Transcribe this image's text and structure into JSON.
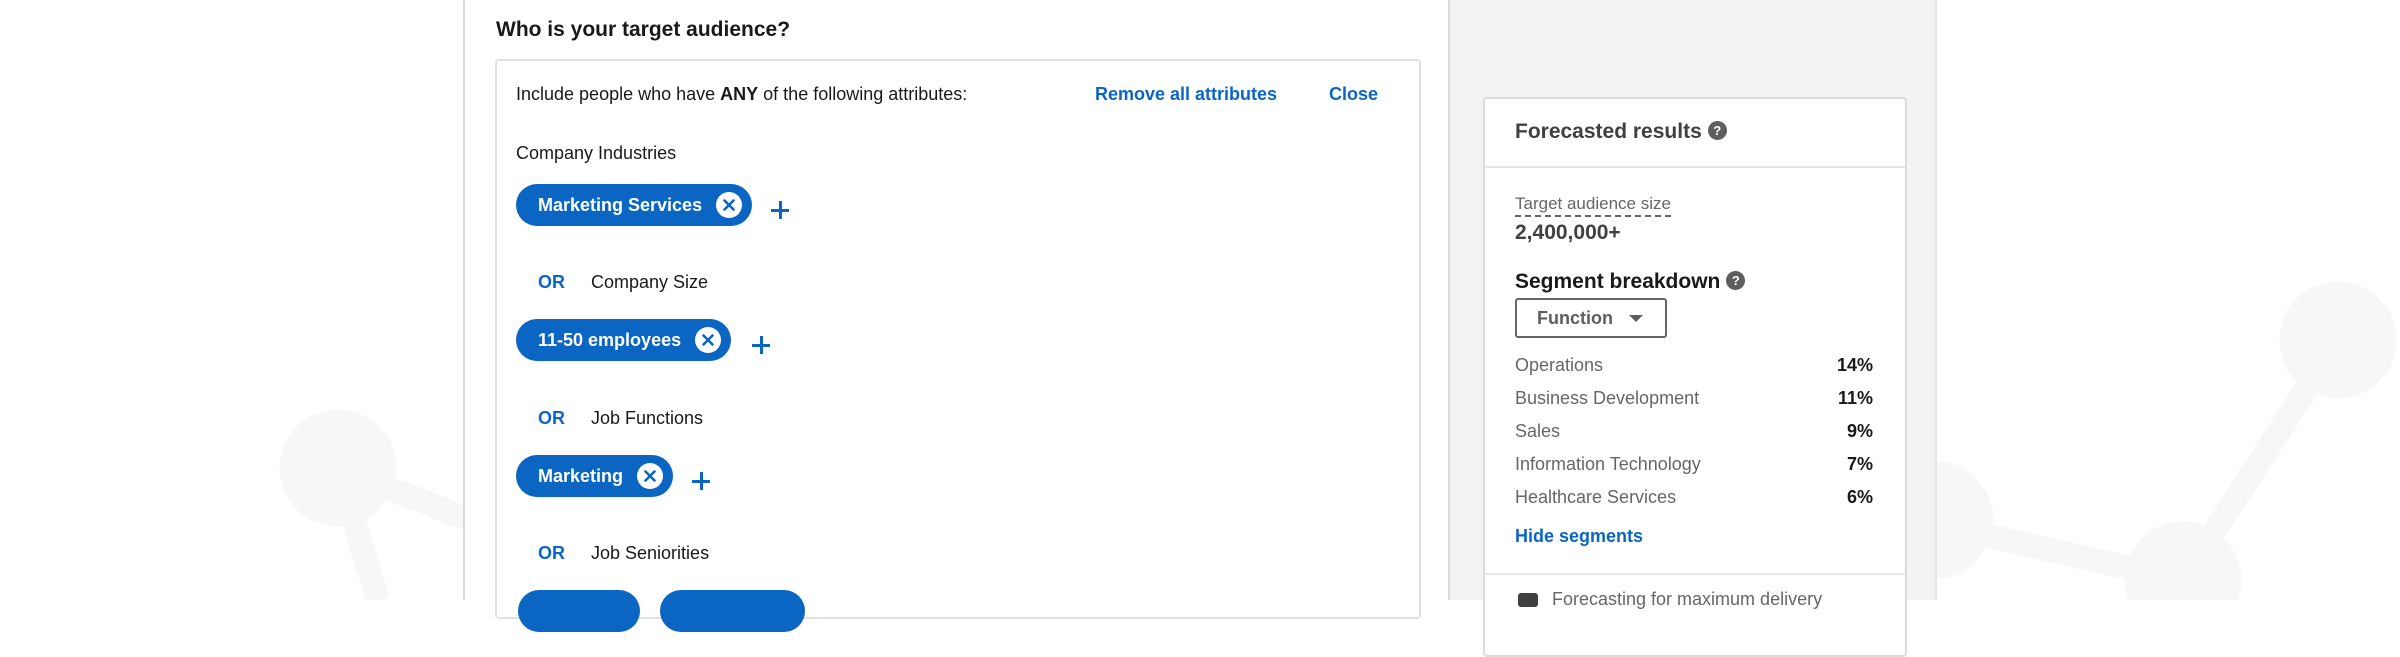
{
  "audience": {
    "heading": "Who is your target audience?",
    "include_prefix": "Include people who have ",
    "include_emphasis": "ANY",
    "include_suffix": " of the following attributes:",
    "remove_all_label": "Remove all attributes",
    "close_label": "Close",
    "or_label": "OR",
    "groups": [
      {
        "label": "Company Industries",
        "chips": [
          "Marketing Services"
        ]
      },
      {
        "label": "Company Size",
        "chips": [
          "11-50 employees"
        ]
      },
      {
        "label": "Job Functions",
        "chips": [
          "Marketing"
        ]
      },
      {
        "label": "Job Seniorities",
        "chips": [
          "",
          ""
        ]
      }
    ]
  },
  "forecast": {
    "title": "Forecasted results",
    "help_icon": "question-circle-icon",
    "audience_size_label": "Target audience size",
    "audience_size_value": "2,400,000+",
    "segment_title": "Segment breakdown",
    "segment_dropdown_value": "Function",
    "segments": [
      {
        "name": "Operations",
        "pct": "14%"
      },
      {
        "name": "Business Development",
        "pct": "11%"
      },
      {
        "name": "Sales",
        "pct": "9%"
      },
      {
        "name": "Information Technology",
        "pct": "7%"
      },
      {
        "name": "Healthcare Services",
        "pct": "6%"
      }
    ],
    "hide_segments_label": "Hide segments",
    "note": "Forecasting for maximum delivery"
  },
  "colors": {
    "accent": "#0a66c2",
    "side_bg": "#f3f3f3",
    "text": "#191919",
    "muted": "#666666"
  }
}
